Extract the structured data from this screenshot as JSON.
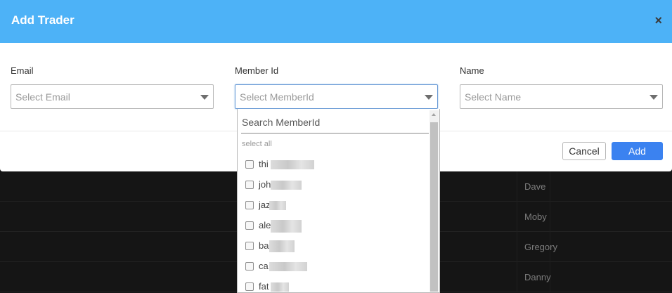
{
  "background_rows": [
    {
      "name": "Dave"
    },
    {
      "name": "Moby"
    },
    {
      "name": "Gregory"
    },
    {
      "name": "Danny"
    }
  ],
  "modal": {
    "title": "Add Trader",
    "close_label": "×",
    "fields": [
      {
        "label": "Email",
        "placeholder": "Select Email"
      },
      {
        "label": "Member Id",
        "placeholder": "Select MemberId"
      },
      {
        "label": "Name",
        "placeholder": "Select Name"
      }
    ],
    "cancel_label": "Cancel",
    "add_label": "Add"
  },
  "dropdown": {
    "search_placeholder": "Search MemberId",
    "select_all_label": "select all",
    "items": [
      {
        "label": "thi"
      },
      {
        "label": "joh"
      },
      {
        "label": "jaz"
      },
      {
        "label": "ale"
      },
      {
        "label": "ba"
      },
      {
        "label": "ca"
      },
      {
        "label": "fat"
      }
    ]
  },
  "colors": {
    "header": "#4db2f7",
    "primary_button": "#3b82f0"
  }
}
